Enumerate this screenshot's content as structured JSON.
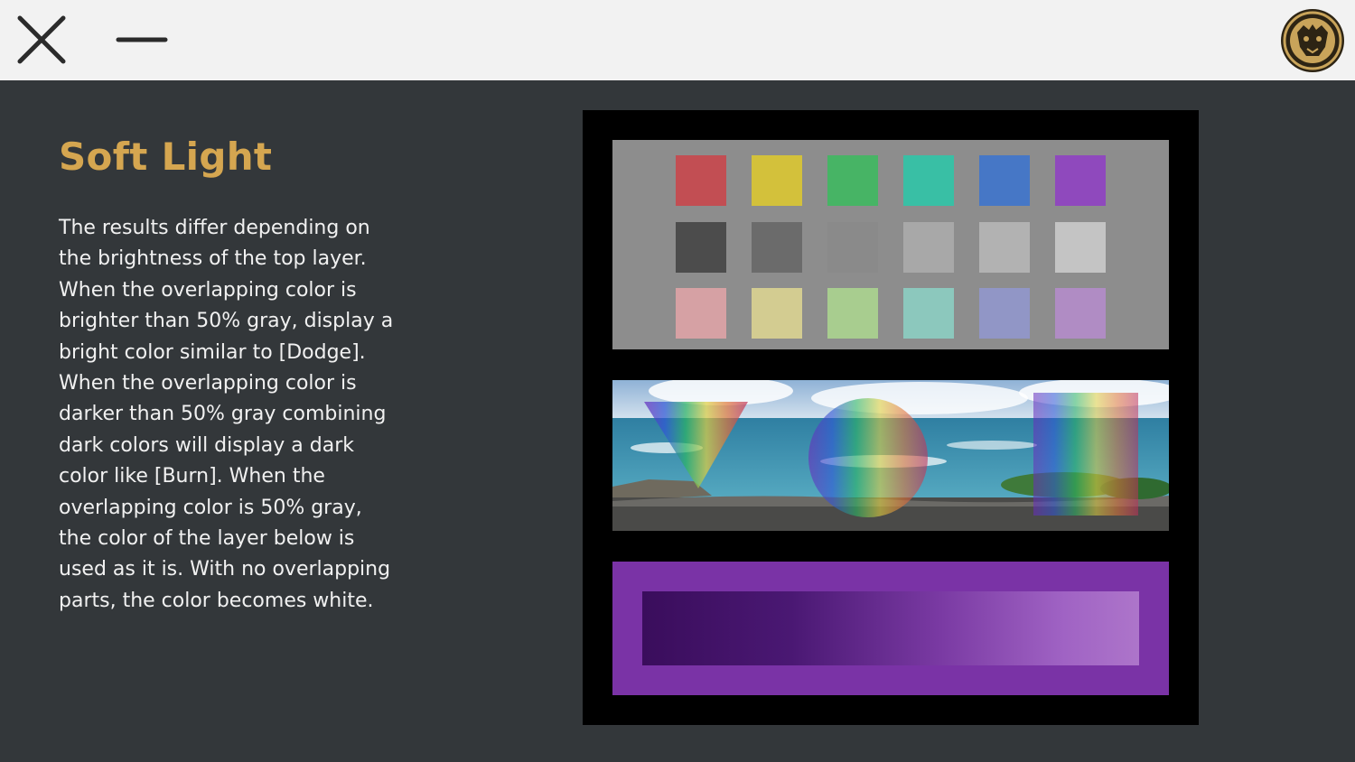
{
  "toolbar": {
    "close_icon": "close-icon",
    "minimize_icon": "minimize-icon",
    "logo_icon": "lion-emblem-icon"
  },
  "content": {
    "title": "Soft Light",
    "description": "The results differ depending on\nthe brightness of the top layer.\nWhen the overlapping color is\nbrighter than 50% gray, display a\nbright color similar to [Dodge].\nWhen the overlapping color is\ndarker than 50% gray combining\ndark colors will display a dark\ncolor like [Burn]. When the\noverlapping color is 50% gray,\nthe color of the layer below is\nused as it is. With no overlapping\nparts, the color becomes white."
  },
  "colors": {
    "accent": "#d5a650",
    "background": "#33373a",
    "topbar": "#f2f2f2"
  },
  "swatches": {
    "row1": [
      "#c24e53",
      "#d3c13b",
      "#47b465",
      "#39bfa5",
      "#4677c6",
      "#8f49bd"
    ],
    "row2": [
      "#4c4c4c",
      "#6b6b6b",
      "#8a8a8a",
      "#a8a8a8",
      "#b2b2b2",
      "#c4c4c4"
    ],
    "row3": [
      "#d6a1a4",
      "#d3cc91",
      "#a8cd8f",
      "#8cc8bd",
      "#9196c6",
      "#b08cc4"
    ]
  }
}
